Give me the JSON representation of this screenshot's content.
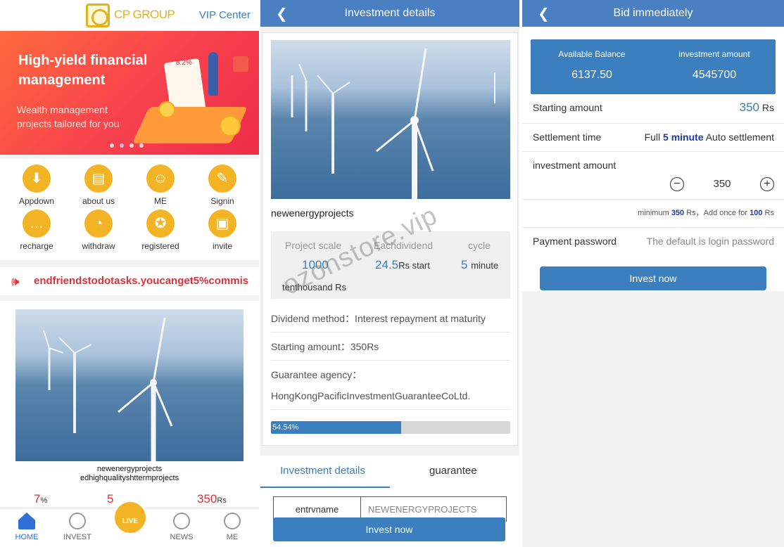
{
  "home": {
    "brand": "CP GROUP",
    "vip_link": "VIP Center",
    "banner": {
      "title": "High-yield financial management",
      "subtitle": "Wealth management projects tailored for you",
      "badge": "8.2%"
    },
    "grid": [
      {
        "label": "Appdown",
        "icon": "download-icon"
      },
      {
        "label": "about us",
        "icon": "document-icon"
      },
      {
        "label": "ME",
        "icon": "user-icon"
      },
      {
        "label": "Signin",
        "icon": "signin-icon"
      },
      {
        "label": "recharge",
        "icon": "chat-icon"
      },
      {
        "label": "withdraw",
        "icon": "pig-icon"
      },
      {
        "label": "registered",
        "icon": "badge-icon"
      },
      {
        "label": "invite",
        "icon": "wallet-icon"
      }
    ],
    "marquee": "endfriendstodotasks.youcanget5%commis",
    "product": {
      "name_line1": "newenergyprojects",
      "name_line2": "edhighqualityshttermprojects",
      "stat1": "7",
      "stat1_unit": "%",
      "stat2": "5",
      "stat3": "350",
      "stat3_unit": "Rs"
    },
    "tabs": {
      "home": "HOME",
      "invest": "INVEST",
      "live": "LIVE",
      "news": "NEWS",
      "me": "ME"
    }
  },
  "details": {
    "header": "Investment details",
    "project_name": "newenergyprojects",
    "stats": {
      "scale_label": "Project scale",
      "scale_value": "1000",
      "scale_unit": "tenthousand Rs",
      "dividend_label": "Eachdividend",
      "dividend_value": "24.5",
      "dividend_unit": "Rs start",
      "cycle_label": "cycle",
      "cycle_value": "5",
      "cycle_unit": "minute"
    },
    "rows": [
      "Dividend method：Interest repayment at maturity",
      "Starting amount：350Rs",
      "Guarantee agency：",
      "HongKongPacificInvestmentGuaranteeCoLtd."
    ],
    "progress_label": "54.54%",
    "progress_fraction": 0.5454,
    "tab_details": "Investment details",
    "tab_guarantee": "guarantee",
    "table_key": "entrvname",
    "table_value": "NEWENERGYPROJECTS",
    "invest_button": "Invest now"
  },
  "bid": {
    "header": "Bid immediately",
    "available_label": "Available Balance",
    "available_value": "6137.50",
    "investment_label": "investment amount",
    "investment_value": "4545700",
    "starting_label": "Starting amount",
    "starting_value": "350",
    "starting_unit": "Rs",
    "settlement_label": "Settlement time",
    "settlement_prefix": "Full",
    "settlement_bold": "5 minute",
    "settlement_suffix": "Auto settlement",
    "amount_label": "investment amount",
    "amount_value": "350",
    "min_prefix": "minimum",
    "min_value": "350",
    "min_mid": "Rs，Add once for",
    "min_step": "100",
    "min_suffix": "Rs",
    "password_label": "Payment password",
    "password_placeholder": "The default is login password",
    "invest_button": "Invest now"
  },
  "watermark": "ozonstore.vip",
  "colors": {
    "accent": "#3b7fbf",
    "header": "#4a7fc1",
    "gold": "#f2b425",
    "red": "#e0303a"
  }
}
